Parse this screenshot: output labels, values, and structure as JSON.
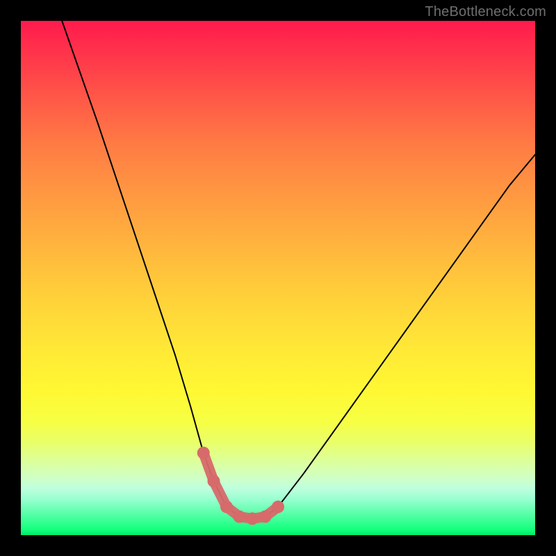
{
  "watermark": "TheBottleneck.com",
  "chart_data": {
    "type": "line",
    "title": "",
    "xlabel": "",
    "ylabel": "",
    "xlim": [
      0,
      100
    ],
    "ylim": [
      0,
      100
    ],
    "series": [
      {
        "name": "curve",
        "x": [
          8,
          15,
          25,
          30,
          33,
          35.5,
          37.5,
          40,
          42.5,
          45,
          47.5,
          50,
          55,
          60,
          65,
          70,
          75,
          80,
          85,
          90,
          95,
          100
        ],
        "values": [
          100,
          80,
          50,
          35,
          25,
          16,
          10.5,
          5.5,
          3.6,
          3.2,
          3.6,
          5.5,
          12,
          19,
          26,
          33,
          40,
          47,
          54,
          61,
          68,
          74
        ]
      },
      {
        "name": "dots",
        "x": [
          35.5,
          37.5,
          40,
          42.5,
          45,
          47.5,
          50
        ],
        "values": [
          16,
          10.5,
          5.5,
          3.6,
          3.2,
          3.6,
          5.5
        ]
      }
    ],
    "colors": {
      "curve": "#000000",
      "dots": "#d76a6a"
    }
  }
}
